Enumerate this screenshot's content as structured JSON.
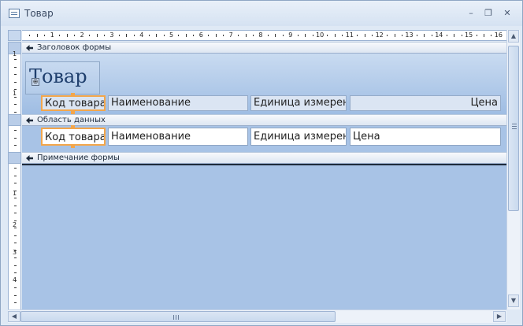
{
  "window": {
    "title": "Товар",
    "minimize_glyph": "–",
    "restore_glyph": "❐",
    "close_glyph": "✕"
  },
  "ruler": {
    "h_numbers": [
      "1",
      "2",
      "3",
      "4",
      "5",
      "6",
      "7",
      "8",
      "9",
      "10",
      "11",
      "12",
      "13",
      "14",
      "15",
      "16"
    ],
    "v_numbers": [
      "1",
      "1",
      "1",
      "2",
      "3",
      "4"
    ]
  },
  "sections": {
    "header": "Заголовок формы",
    "detail": "Область данных",
    "footer": "Примечание формы"
  },
  "form_title": "Товар",
  "header_labels": [
    "Код товара",
    "Наименование",
    "Единица измерен",
    "Цена"
  ],
  "detail_fields": [
    "Код товара",
    "Наименование",
    "Единица измерени",
    "Цена"
  ],
  "icons": {
    "move_handle": "move-handle-icon",
    "section_arrow": "section-arrow-icon"
  },
  "colors": {
    "selection": "#f3a64b",
    "design_background": "#a8c3e6"
  }
}
